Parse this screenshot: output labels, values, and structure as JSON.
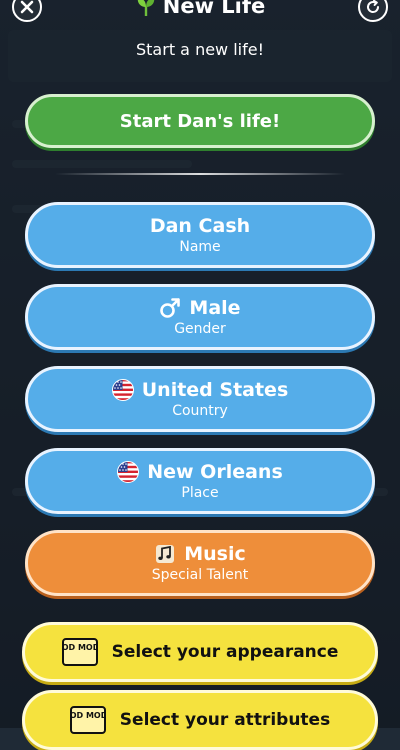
{
  "header": {
    "title": "New Life",
    "subtitle": "Start a new life!"
  },
  "start_button": {
    "label": "Start Dan's life!"
  },
  "options": [
    {
      "id": "name",
      "value": "Dan Cash",
      "caption": "Name"
    },
    {
      "id": "gender",
      "value": "Male",
      "caption": "Gender",
      "icon": "male-symbol-icon"
    },
    {
      "id": "country",
      "value": "United States",
      "caption": "Country",
      "icon": "us-flag-icon"
    },
    {
      "id": "place",
      "value": "New Orleans",
      "caption": "Place",
      "icon": "us-flag-icon"
    },
    {
      "id": "talent",
      "value": "Music",
      "caption": "Special Talent",
      "icon": "music-note-icon"
    }
  ],
  "god_mode": {
    "badge_text": "GOD MODE",
    "appearance_label": "Select your appearance",
    "attributes_label": "Select your attributes"
  },
  "colors": {
    "green": "#4ca845",
    "blue": "#55ade9",
    "orange": "#ee8e3a",
    "yellow": "#f5e23e",
    "background": "#1f2a36"
  }
}
